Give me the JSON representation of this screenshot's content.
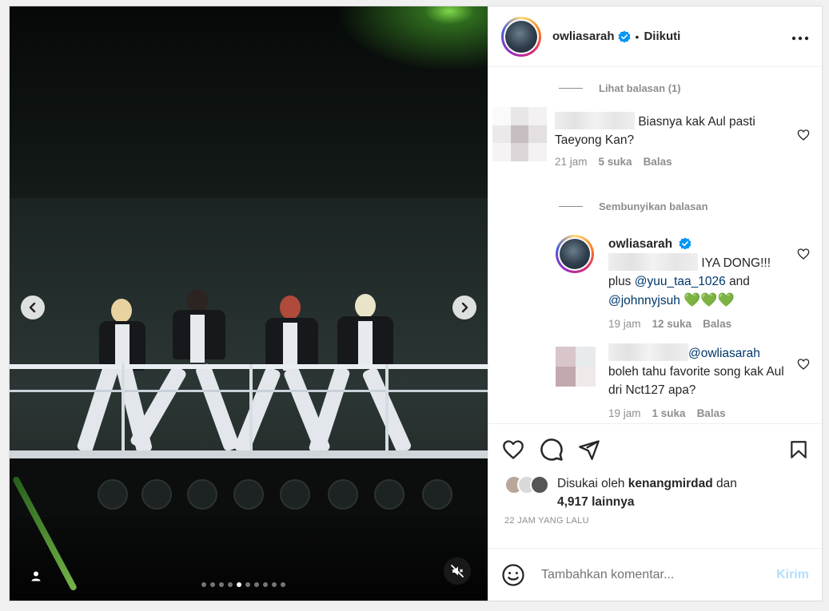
{
  "post": {
    "username": "owliasarah",
    "separator": "•",
    "follow_status": "Diikuti",
    "more_icon": "more-horizontal-icon"
  },
  "media": {
    "carousel_dots": 10,
    "active_dot": 4,
    "prev_icon": "chevron-left-icon",
    "next_icon": "chevron-right-icon",
    "mute_icon": "speaker-muted-icon",
    "tag_icon": "user-tag-icon"
  },
  "comments": {
    "view_replies": "Lihat balasan (1)",
    "hide_replies": "Sembunyikan balasan",
    "items": [
      {
        "text": "Biasnya kak Aul pasti Taeyong Kan?",
        "time": "21 jam",
        "likes": "5 suka",
        "reply": "Balas"
      },
      {
        "username": "owliasarah",
        "text_a": "IYA DONG!!!",
        "text_b": "plus",
        "mention_1": "@yuu_taa_1026",
        "text_c": "and",
        "mention_2": "@johnnyjsuh",
        "emoji": "💚💚💚",
        "time": "19 jam",
        "likes": "12 suka",
        "reply": "Balas"
      },
      {
        "mention": "@owliasarah",
        "text": "boleh tahu favorite song kak Aul dri Nct127 apa?",
        "time": "19 jam",
        "likes": "1 suka",
        "reply": "Balas"
      }
    ]
  },
  "actions": {
    "like_icon": "heart-icon",
    "comment_icon": "comment-icon",
    "share_icon": "send-icon",
    "save_icon": "bookmark-icon"
  },
  "likes": {
    "prefix": "Disukai oleh",
    "user": "kenangmirdad",
    "and": "dan",
    "count": "4,917 lainnya"
  },
  "timestamp": "22 JAM YANG LALU",
  "add_comment": {
    "placeholder": "Tambahkan komentar...",
    "send_label": "Kirim",
    "emoji_icon": "emoji-icon"
  }
}
